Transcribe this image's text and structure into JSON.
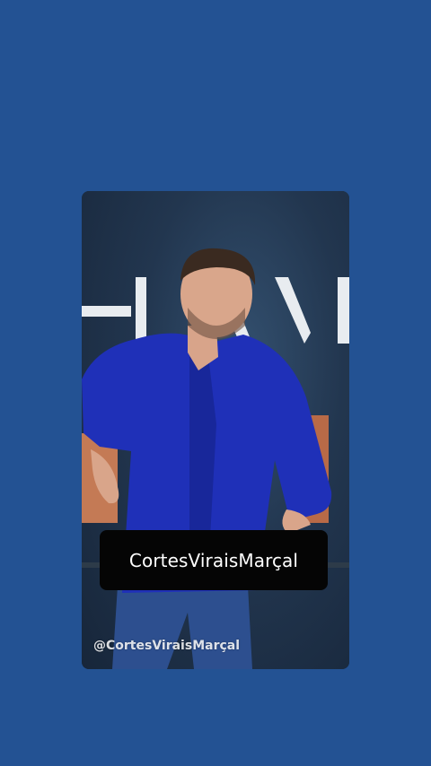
{
  "caption": {
    "text": "CortesViraisMarçal"
  },
  "watermark": {
    "text": "@CortesViraisMarçal"
  },
  "colors": {
    "background": "#235293",
    "caption_bg": "#050505",
    "shirt": "#1f30b8"
  }
}
